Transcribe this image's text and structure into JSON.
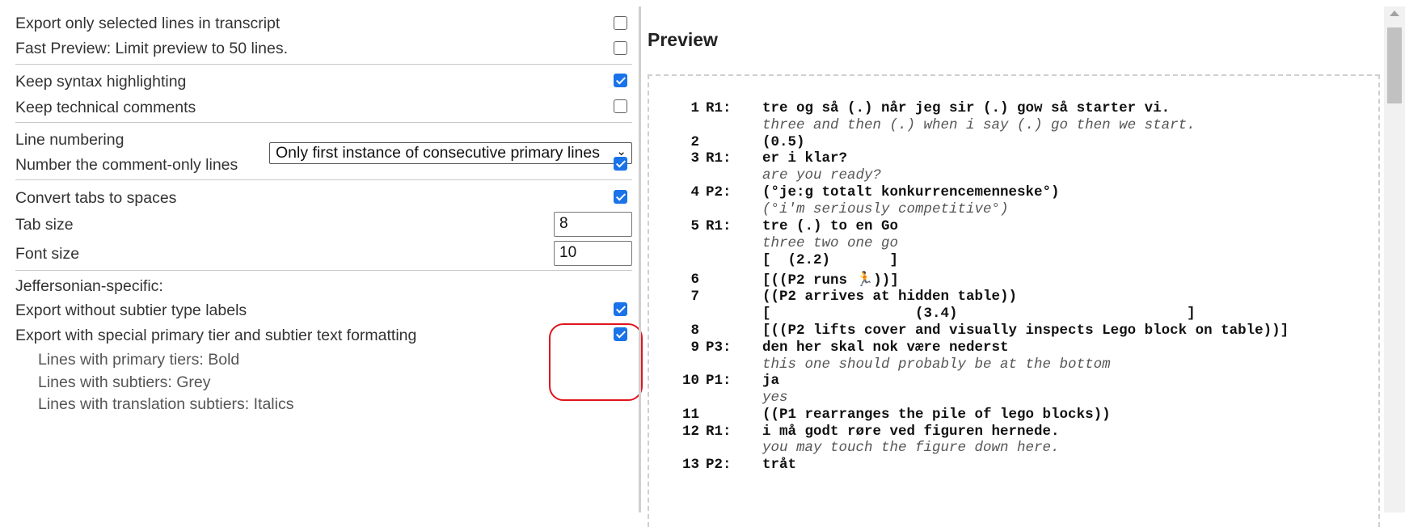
{
  "options": {
    "export_selected": "Export only selected lines in transcript",
    "fast_preview": "Fast Preview: Limit preview to 50 lines.",
    "keep_syntax": "Keep syntax highlighting",
    "keep_comments": "Keep technical comments",
    "line_numbering": "Line numbering",
    "line_numbering_value": "Only first instance of consecutive primary lines",
    "number_comment_lines": "Number the comment-only lines",
    "convert_tabs": "Convert tabs to spaces",
    "tab_size": "Tab size",
    "tab_size_value": "8",
    "font_size": "Font size",
    "font_size_value": "10",
    "jeff_header": "Jeffersonian-specific:",
    "no_subtier_labels": "Export without subtier type labels",
    "special_formatting": "Export with special primary tier and subtier text formatting",
    "primary_bold": "Lines with primary tiers: Bold",
    "subtier_grey": "Lines with subtiers: Grey",
    "translation_italics": "Lines with translation subtiers: Italics"
  },
  "checkboxes": {
    "export_selected": false,
    "fast_preview": false,
    "keep_syntax": true,
    "keep_comments": false,
    "number_comment_lines": true,
    "convert_tabs": true,
    "no_subtier_labels": true,
    "special_formatting": true
  },
  "preview": {
    "title": "Preview",
    "lines": [
      {
        "n": "1",
        "sp": "R1:",
        "text": "tre og så (.) når jeg sir (.) gow så starter vi.",
        "style": "b"
      },
      {
        "n": "",
        "sp": "",
        "text": "three and then (.) when i say (.) go then we start.",
        "style": "i"
      },
      {
        "n": "2",
        "sp": "",
        "text": "(0.5)",
        "style": "b"
      },
      {
        "n": "3",
        "sp": "R1:",
        "text": "er i klar?",
        "style": "b"
      },
      {
        "n": "",
        "sp": "",
        "text": "are you ready?",
        "style": "i"
      },
      {
        "n": "4",
        "sp": "P2:",
        "text": "(°je:g totalt konkurrencemenneske°)",
        "style": "b"
      },
      {
        "n": "",
        "sp": "",
        "text": "(°i'm seriously competitive°)",
        "style": "i"
      },
      {
        "n": "5",
        "sp": "R1:",
        "text": "tre (.) to en Go",
        "style": "b"
      },
      {
        "n": "",
        "sp": "",
        "text": "three two one go",
        "style": "i"
      },
      {
        "n": "",
        "sp": "",
        "text": "[  (2.2)       ]",
        "style": "b"
      },
      {
        "n": "6",
        "sp": "",
        "text": "[((P2 runs 🏃))]",
        "style": "b"
      },
      {
        "n": "7",
        "sp": "",
        "text": "((P2 arrives at hidden table))",
        "style": "b"
      },
      {
        "n": "",
        "sp": "",
        "text": "[                 (3.4)                           ]",
        "style": "b"
      },
      {
        "n": "8",
        "sp": "",
        "text": "[((P2 lifts cover and visually inspects Lego block on table))]",
        "style": "b"
      },
      {
        "n": "9",
        "sp": "P3:",
        "text": "den her skal nok være nederst",
        "style": "b"
      },
      {
        "n": "",
        "sp": "",
        "text": "this one should probably be at the bottom",
        "style": "i"
      },
      {
        "n": "10",
        "sp": "P1:",
        "text": "ja",
        "style": "b"
      },
      {
        "n": "",
        "sp": "",
        "text": "yes",
        "style": "i"
      },
      {
        "n": "11",
        "sp": "",
        "text": "((P1 rearranges the pile of lego blocks))",
        "style": "b"
      },
      {
        "n": "12",
        "sp": "R1:",
        "text": "i må godt røre ved figuren hernede.",
        "style": "b"
      },
      {
        "n": "",
        "sp": "",
        "text": "you may touch the figure down here.",
        "style": "i"
      },
      {
        "n": "13",
        "sp": "P2:",
        "text": "tråt",
        "style": "b"
      }
    ]
  }
}
